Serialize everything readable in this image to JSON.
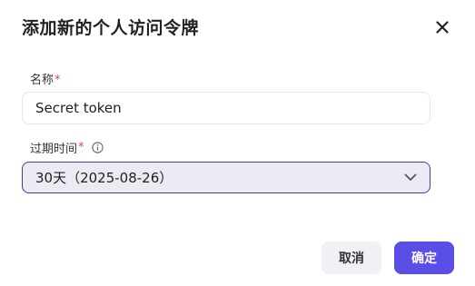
{
  "dialog": {
    "title": "添加新的个人访问令牌",
    "close_icon": "close-icon"
  },
  "form": {
    "name": {
      "label": "名称",
      "required_mark": "*",
      "value": "Secret token"
    },
    "expiry": {
      "label": "过期时间",
      "required_mark": "*",
      "info_icon": "info-icon",
      "selected": "30天（2025-08-26）",
      "chevron_icon": "chevron-down-icon"
    }
  },
  "actions": {
    "cancel_label": "取消",
    "confirm_label": "确定"
  },
  "colors": {
    "primary": "#5a4ee6",
    "required": "#e5484d",
    "select_border": "#3d3f8f",
    "select_bg": "#ecebf4"
  }
}
